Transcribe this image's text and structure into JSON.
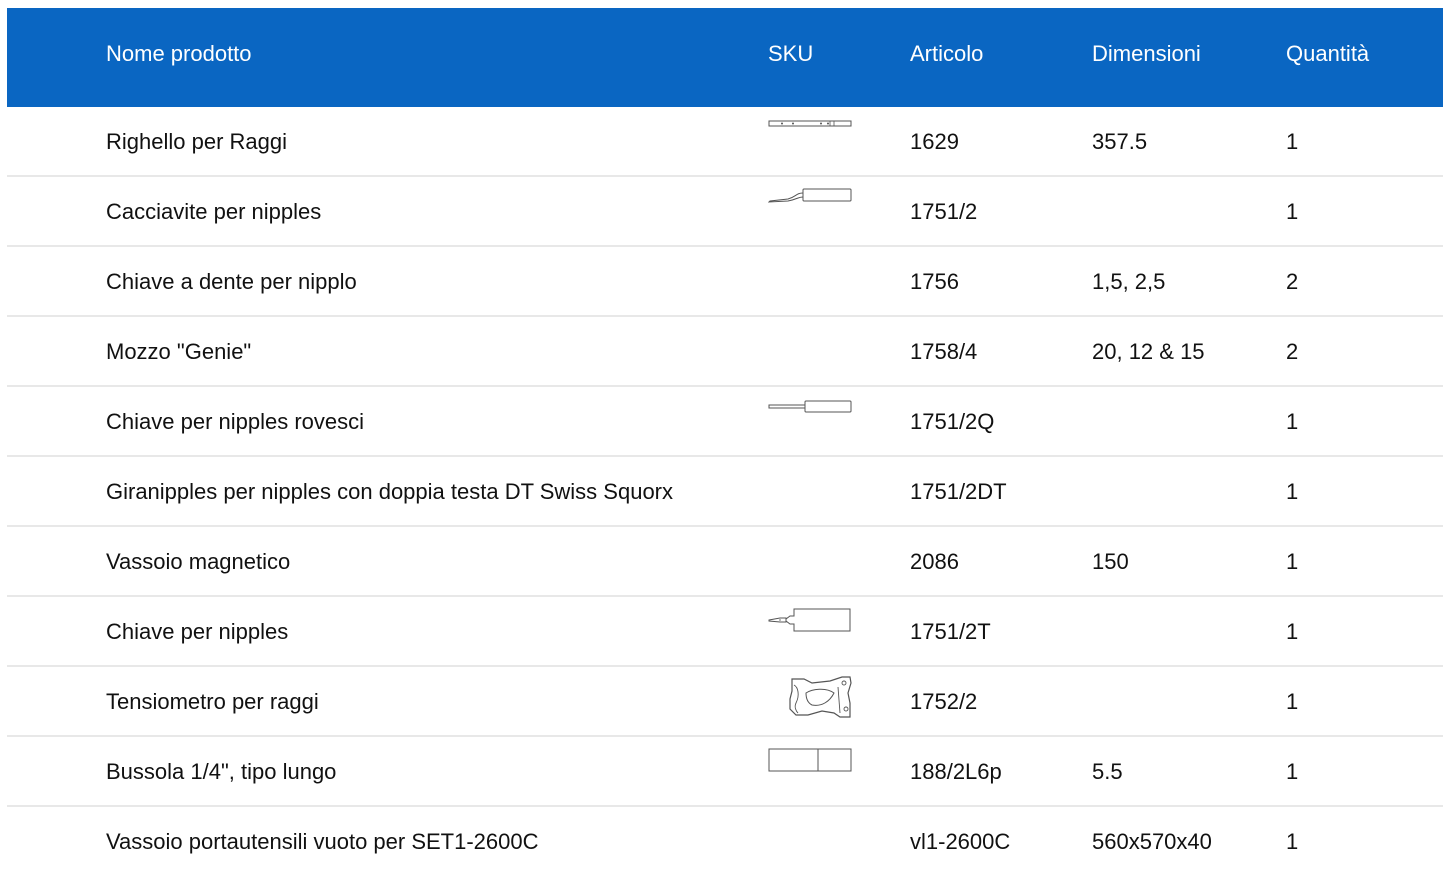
{
  "headers": {
    "name": "Nome prodotto",
    "sku": "SKU",
    "article": "Articolo",
    "dimensions": "Dimensioni",
    "quantity": "Quantità"
  },
  "rows": [
    {
      "name": "Righello per Raggi",
      "sku_icon": "ruler-icon",
      "article": "1629",
      "dimensions": "357.5",
      "quantity": "1"
    },
    {
      "name": "Cacciavite per nipples",
      "sku_icon": "bent-screwdriver-icon",
      "article": "1751/2",
      "dimensions": "",
      "quantity": "1"
    },
    {
      "name": "Chiave a dente per nipplo",
      "sku_icon": "",
      "article": "1756",
      "dimensions": "1,5, 2,5",
      "quantity": "2"
    },
    {
      "name": "Mozzo \"Genie\"",
      "sku_icon": "",
      "article": "1758/4",
      "dimensions": "20, 12 & 15",
      "quantity": "2"
    },
    {
      "name": "Chiave per nipples rovesci",
      "sku_icon": "screwdriver-icon",
      "article": "1751/2Q",
      "dimensions": "",
      "quantity": "1"
    },
    {
      "name": "Giranipples per nipples con doppia testa DT Swiss Squorx",
      "sku_icon": "",
      "article": "1751/2DT",
      "dimensions": "",
      "quantity": "1"
    },
    {
      "name": "Vassoio magnetico",
      "sku_icon": "",
      "article": "2086",
      "dimensions": "150",
      "quantity": "1"
    },
    {
      "name": "Chiave per nipples",
      "sku_icon": "nipple-key-icon",
      "article": "1751/2T",
      "dimensions": "",
      "quantity": "1"
    },
    {
      "name": "Tensiometro per raggi",
      "sku_icon": "tensiometer-icon",
      "article": "1752/2",
      "dimensions": "",
      "quantity": "1"
    },
    {
      "name": "Bussola 1/4\", tipo lungo",
      "sku_icon": "socket-icon",
      "article": "188/2L6p",
      "dimensions": "5.5",
      "quantity": "1"
    },
    {
      "name": "Vassoio portautensili vuoto per SET1-2600C",
      "sku_icon": "",
      "article": "vl1-2600C",
      "dimensions": "560x570x40",
      "quantity": "1"
    }
  ],
  "colors": {
    "header_bg": "#0a66c2",
    "header_text": "#ffffff",
    "row_divider": "#e8e8e8"
  }
}
